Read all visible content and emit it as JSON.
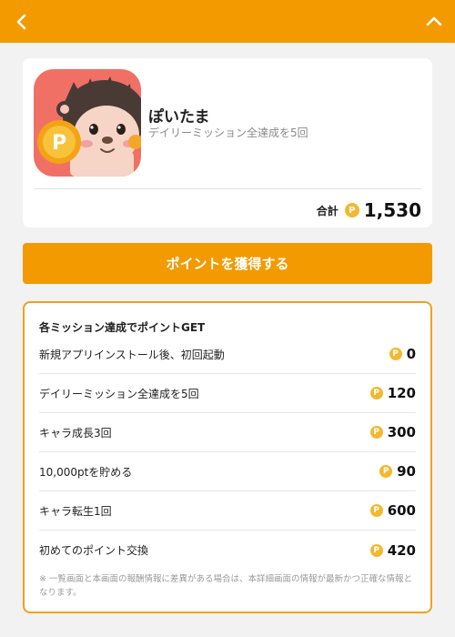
{
  "app": {
    "name": "ぽいたま",
    "description": "デイリーミッション全達成を5回",
    "total_label": "合計",
    "total_value": "1,530"
  },
  "cta": {
    "label": "ポイントを獲得する"
  },
  "missions": {
    "title": "各ミッション達成でポイントGET",
    "items": [
      {
        "label": "新規アプリインストール後、初回起動",
        "points": "0"
      },
      {
        "label": "デイリーミッション全達成を5回",
        "points": "120"
      },
      {
        "label": "キャラ成長3回",
        "points": "300"
      },
      {
        "label": "10,000ptを貯める",
        "points": "90"
      },
      {
        "label": "キャラ転生1回",
        "points": "600"
      },
      {
        "label": "初めてのポイント交換",
        "points": "420"
      }
    ],
    "note": "※ 一覧画面と本画面の報酬情報に差異がある場合は、本詳細画面の情報が最新かつ正確な情報となります。"
  },
  "colors": {
    "accent": "#f39a00",
    "coin": "#f4b830",
    "border": "#f0a21b"
  },
  "icons": {
    "back": "chevron-left-icon",
    "collapse": "chevron-up-icon",
    "coin": "point-coin-icon",
    "app": "app-icon"
  }
}
